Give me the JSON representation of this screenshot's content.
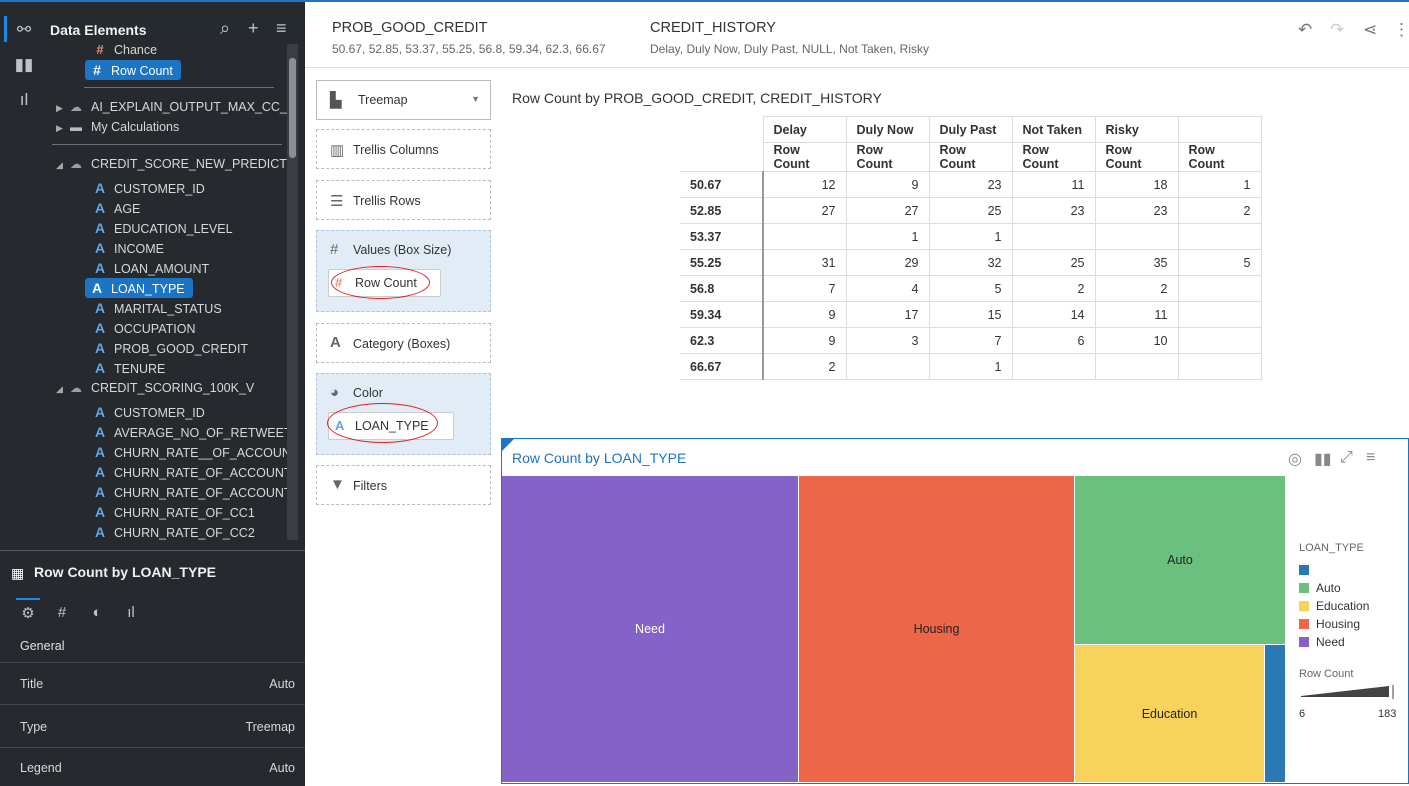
{
  "left_panel": {
    "header": "Data Elements",
    "tree": {
      "chance": "Chance",
      "row_count": "Row Count",
      "ai_explain": "AI_EXPLAIN_OUTPUT_MAX_CC_",
      "my_calc": "My Calculations",
      "ds1": "CREDIT_SCORE_NEW_PREDICT",
      "ds1_cols": [
        "CUSTOMER_ID",
        "AGE",
        "EDUCATION_LEVEL",
        "INCOME",
        "LOAN_AMOUNT",
        "LOAN_TYPE",
        "MARITAL_STATUS",
        "OCCUPATION",
        "PROB_GOOD_CREDIT",
        "TENURE"
      ],
      "ds2": "CREDIT_SCORING_100K_V",
      "ds2_cols": [
        "CUSTOMER_ID",
        "AVERAGE_NO_OF_RETWEETS",
        "CHURN_RATE__OF_ACCOUN",
        "CHURN_RATE_OF_ACCOUNT",
        "CHURN_RATE_OF_ACCOUNT",
        "CHURN_RATE_OF_CC1",
        "CHURN_RATE_OF_CC2"
      ]
    },
    "properties": {
      "title": "Row Count by LOAN_TYPE",
      "section": "General",
      "rows": [
        {
          "label": "Title",
          "value": "Auto"
        },
        {
          "label": "Type",
          "value": "Treemap"
        },
        {
          "label": "Legend",
          "value": "Auto"
        }
      ]
    }
  },
  "filter_bar": {
    "f1_title": "PROB_GOOD_CREDIT",
    "f1_values": "50.67, 52.85, 53.37, 55.25, 56.8, 59.34, 62.3, 66.67",
    "f2_title": "CREDIT_HISTORY",
    "f2_values": "Delay, Duly Now, Duly Past, NULL, Not Taken, Risky"
  },
  "grammar": {
    "viz_type": "Treemap",
    "trellis_columns": "Trellis Columns",
    "trellis_rows": "Trellis Rows",
    "values_label": "Values (Box Size)",
    "values_pill": "Row Count",
    "category_label": "Category (Boxes)",
    "color_label": "Color",
    "color_pill": "LOAN_TYPE",
    "filters_label": "Filters"
  },
  "pivot": {
    "title": "Row Count by PROB_GOOD_CREDIT, CREDIT_HISTORY",
    "columns": [
      "Delay",
      "Duly Now",
      "Duly Past",
      "Not Taken",
      "Risky",
      ""
    ],
    "measure_label": "Row Count",
    "rows": [
      {
        "key": "50.67",
        "values": [
          "12",
          "9",
          "23",
          "11",
          "18",
          "1"
        ]
      },
      {
        "key": "52.85",
        "values": [
          "27",
          "27",
          "25",
          "23",
          "23",
          "2"
        ]
      },
      {
        "key": "53.37",
        "values": [
          "",
          "1",
          "1",
          "",
          "",
          ""
        ]
      },
      {
        "key": "55.25",
        "values": [
          "31",
          "29",
          "32",
          "25",
          "35",
          "5"
        ]
      },
      {
        "key": "56.8",
        "values": [
          "7",
          "4",
          "5",
          "2",
          "2",
          ""
        ]
      },
      {
        "key": "59.34",
        "values": [
          "9",
          "17",
          "15",
          "14",
          "11",
          ""
        ]
      },
      {
        "key": "62.3",
        "values": [
          "9",
          "3",
          "7",
          "6",
          "10",
          ""
        ]
      },
      {
        "key": "66.67",
        "values": [
          "2",
          "",
          "1",
          "",
          "",
          ""
        ]
      }
    ]
  },
  "treemap": {
    "title": "Row Count by LOAN_TYPE",
    "tiles": {
      "need": {
        "label": "Need",
        "color": "#8562c8"
      },
      "housing": {
        "label": "Housing",
        "color": "#ed6647"
      },
      "auto": {
        "label": "Auto",
        "color": "#6bc07f"
      },
      "education": {
        "label": "Education",
        "color": "#f7d35b"
      },
      "blank": {
        "label": "",
        "color": "#2b79b4"
      }
    },
    "legend_title": "LOAN_TYPE",
    "legend": [
      {
        "label": "",
        "color": "#2b79b4"
      },
      {
        "label": "Auto",
        "color": "#6bc07f"
      },
      {
        "label": "Education",
        "color": "#f7d35b"
      },
      {
        "label": "Housing",
        "color": "#ed6647"
      },
      {
        "label": "Need",
        "color": "#8562c8"
      }
    ],
    "size_title": "Row Count",
    "size_min": "6",
    "size_max": "183"
  }
}
